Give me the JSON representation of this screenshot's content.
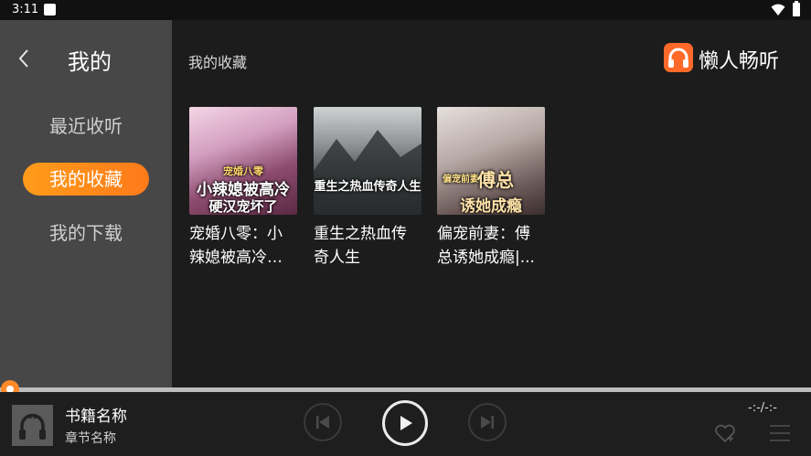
{
  "status_bar": {
    "time": "3:11"
  },
  "sidebar": {
    "title": "我的",
    "items": [
      {
        "label": "最近收听",
        "active": false
      },
      {
        "label": "我的收藏",
        "active": true
      },
      {
        "label": "我的下载",
        "active": false
      }
    ]
  },
  "main": {
    "title": "我的收藏",
    "brand_name": "懒人畅听",
    "books": [
      {
        "title": "宠婚八零：小辣媳被高冷硬汉宠坏了",
        "cover_lines": [
          "宠婚八零",
          "小辣媳被高冷",
          "硬汉宠坏了"
        ]
      },
      {
        "title": "重生之热血传奇人生",
        "cover_lines": [
          "重生之热血传奇人生"
        ]
      },
      {
        "title": "偏宠前妻：傅总诱她成瘾|...",
        "cover_lines": [
          "偏宠前妻",
          "傅总",
          "诱她成瘾"
        ]
      }
    ]
  },
  "player": {
    "book_name": "书籍名称",
    "chapter_name": "章节名称",
    "time_display": "-:-/-:-",
    "progress": 0
  },
  "colors": {
    "accent": "#ff8a1f",
    "sidebar_bg": "#474747",
    "page_bg": "#1c1c1c"
  }
}
